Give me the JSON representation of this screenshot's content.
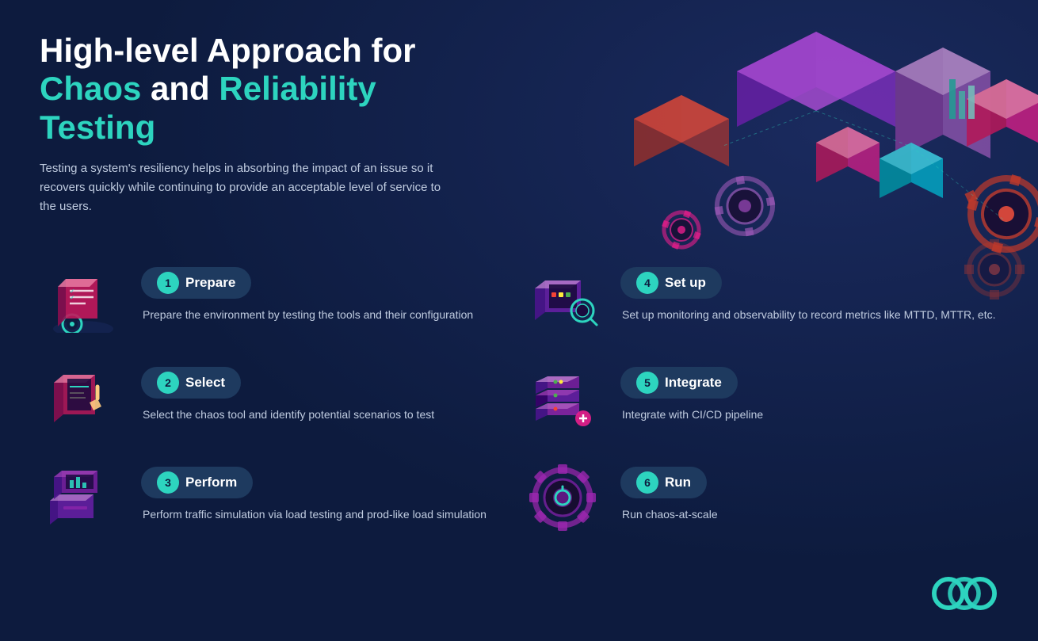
{
  "page": {
    "background_color": "#0d1b3e",
    "accent_color": "#2dd4bf",
    "secondary_accent": "#e040fb"
  },
  "header": {
    "title_line1": "High-level Approach for",
    "title_line2_chaos": "Chaos",
    "title_line2_middle": " and ",
    "title_line2_reliability": "Reliability Testing",
    "subtitle": "Testing a system's resiliency helps in absorbing the impact of an issue so it recovers quickly while continuing to provide an acceptable level of service to the users."
  },
  "steps": [
    {
      "number": "1",
      "title": "Prepare",
      "description": "Prepare the environment by testing the tools and their configuration",
      "icon_type": "document-checklist"
    },
    {
      "number": "4",
      "title": "Set up",
      "description": "Set up monitoring and observability to record metrics like MTTD, MTTR, etc.",
      "icon_type": "monitor-search"
    },
    {
      "number": "2",
      "title": "Select",
      "description": "Select the chaos tool and identify potential scenarios to test",
      "icon_type": "hand-click"
    },
    {
      "number": "5",
      "title": "Integrate",
      "description": "Integrate with CI/CD pipeline",
      "icon_type": "server-stack"
    },
    {
      "number": "3",
      "title": "Perform",
      "description": "Perform traffic simulation via load testing and prod-like load simulation",
      "icon_type": "laptop-chart"
    },
    {
      "number": "6",
      "title": "Run",
      "description": "Run chaos-at-scale",
      "icon_type": "gear-run"
    }
  ]
}
